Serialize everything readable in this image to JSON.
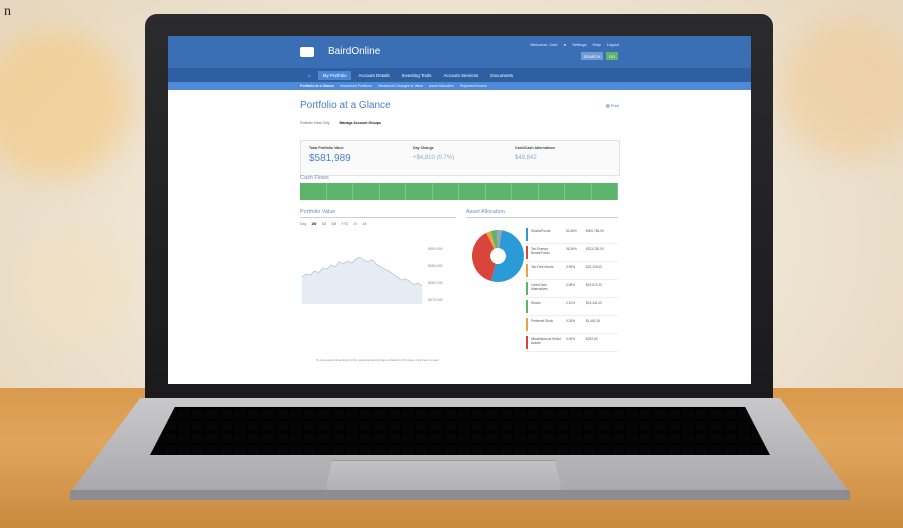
{
  "page": {
    "letter": "n"
  },
  "app": {
    "brand": "BairdOnline",
    "header_links": [
      "Settings",
      "Help",
      "Logout"
    ],
    "header_user": "Welcome, User",
    "header_search_label": "SEARCH",
    "header_go_label": "GO"
  },
  "nav": {
    "items": [
      {
        "label": "My Portfolio",
        "active": true
      },
      {
        "label": "Account Details",
        "active": false
      },
      {
        "label": "Investing Tools",
        "active": false
      },
      {
        "label": "Account Services",
        "active": false
      },
      {
        "label": "Documents",
        "active": false
      }
    ],
    "home_icon": "home-icon"
  },
  "subnav": {
    "items": [
      "Portfolio at a Glance",
      "Household Positions",
      "Household Changes in Value",
      "Asset Allocation",
      "Projected Income"
    ]
  },
  "main": {
    "title": "Portfolio at a Glance",
    "print_label": "Print",
    "view_tabs": [
      {
        "label": "Portfolio View Only",
        "on": false
      },
      {
        "label": "Manage Account Groups",
        "on": true
      }
    ]
  },
  "summary": {
    "portfolio_value_label": "Total Portfolio Value",
    "portfolio_value": "$581,989",
    "day_change_label": "Day Change",
    "day_change": "+$4,810 (0.7%)",
    "cash_label": "Cash/Cash Alternatives",
    "cash_value": "$49,842"
  },
  "cash_flows": {
    "title": "Cash Flows",
    "cells": [
      "",
      "",
      "",
      "",
      "",
      "",
      "",
      "",
      "",
      "",
      "",
      ""
    ]
  },
  "portfolio_value": {
    "title": "Portfolio Value",
    "ranges": [
      {
        "label": "Day",
        "on": false
      },
      {
        "label": "1W",
        "on": true
      },
      {
        "label": "1M",
        "on": false
      },
      {
        "label": "3M",
        "on": false
      },
      {
        "label": "YTD",
        "on": false
      },
      {
        "label": "1Y",
        "on": false
      },
      {
        "label": "All",
        "on": false
      }
    ],
    "y_ticks": [
      "$590,000",
      "$585,000",
      "$580,000",
      "$575,000"
    ],
    "series": [
      0.55,
      0.5,
      0.52,
      0.45,
      0.48,
      0.4,
      0.42,
      0.35,
      0.38,
      0.3,
      0.33,
      0.28,
      0.32,
      0.25,
      0.22,
      0.27,
      0.3,
      0.26,
      0.34,
      0.38,
      0.42,
      0.45,
      0.5,
      0.55,
      0.6,
      0.58,
      0.62,
      0.68,
      0.65,
      0.7
    ]
  },
  "asset_allocation": {
    "title": "Asset Allocation",
    "colors": {
      "blue": "#2a9bd7",
      "red": "#d9453b",
      "orange": "#f0a23c",
      "green": "#5bb56c",
      "gray": "#9aa3ad"
    },
    "slices": [
      {
        "color": "#2a9bd7",
        "value": 0.52
      },
      {
        "color": "#d9453b",
        "value": 0.38
      },
      {
        "color": "#f0a23c",
        "value": 0.03
      },
      {
        "color": "#5bb56c",
        "value": 0.04
      },
      {
        "color": "#9aa3ad",
        "value": 0.03
      }
    ],
    "legend": [
      {
        "name": "Stocks/Funds",
        "pct": "51.66%",
        "value": "$300,766.00",
        "color": "#2a9bd7"
      },
      {
        "name": "Tax-Exempt Bonds/Funds",
        "pct": "38.36%",
        "value": "$223,230.00",
        "color": "#d9453b"
      },
      {
        "name": "Tax-Free Bonds",
        "pct": "3.99%",
        "value": "$23,226.00",
        "color": "#f0a23c"
      },
      {
        "name": "Cash/Cash Alternatives",
        "pct": "3.38%",
        "value": "$19,671.00",
        "color": "#5bb56c"
      },
      {
        "name": "Stocks",
        "pct": "2.31%",
        "value": "$13,441.00",
        "color": "#5bb56c"
      },
      {
        "name": "Preferred Stock",
        "pct": "0.25%",
        "value": "$1,461.00",
        "color": "#f0a23c"
      },
      {
        "name": "Miscellaneous Select Assets",
        "pct": "0.05%",
        "value": "$292.00",
        "color": "#d9453b"
      }
    ]
  },
  "footer": {
    "note": "To view account settings for the accounts and groups included in this view, click here to view."
  }
}
